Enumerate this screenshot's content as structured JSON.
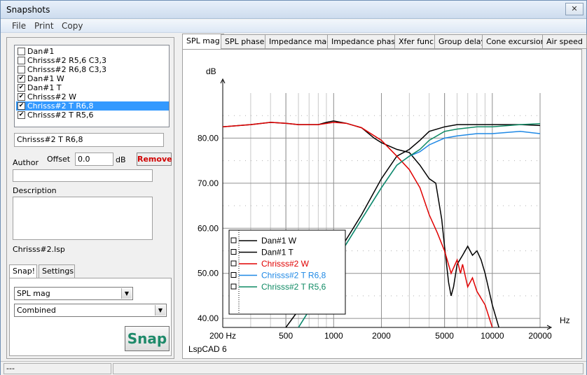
{
  "window": {
    "title": "Snapshots",
    "close": "✕"
  },
  "menu": [
    "File",
    "Print",
    "Copy"
  ],
  "snapshots": [
    {
      "label": "Dan#1",
      "checked": false,
      "selected": false
    },
    {
      "label": "Chrisss#2 R5,6 C3,3",
      "checked": false,
      "selected": false
    },
    {
      "label": "Chrisss#2 R6,8 C3,3",
      "checked": false,
      "selected": false
    },
    {
      "label": "Dan#1 W",
      "checked": true,
      "selected": false
    },
    {
      "label": "Dan#1 T",
      "checked": true,
      "selected": false
    },
    {
      "label": "Chrisss#2 W",
      "checked": true,
      "selected": false
    },
    {
      "label": "Chrisss#2 T R6,8",
      "checked": true,
      "selected": true
    },
    {
      "label": "Chrisss#2 T R5,6",
      "checked": true,
      "selected": false
    }
  ],
  "name_field": {
    "value": "Chrisss#2 T R6,8"
  },
  "author_label": "Author",
  "offset": {
    "label": "Offset",
    "value": "0.0",
    "unit": "dB"
  },
  "remove_label": "Remove",
  "author_value": "",
  "description_label": "Description",
  "description_value": "",
  "file_name": "Chrisss#2.lsp",
  "left_tabs": [
    "Snap!",
    "Settings"
  ],
  "measure_select": "SPL mag",
  "mode_select": "Combined",
  "snap_label": "Snap",
  "chart_tabs": [
    "SPL mag",
    "SPL phase",
    "Impedance mag",
    "Impedance phase",
    "Xfer func",
    "Group delay",
    "Cone excursion",
    "Air speed"
  ],
  "status": "---",
  "chart_data": {
    "type": "line",
    "ylabel": "dB",
    "xlabel": "Hz",
    "x_scale": "log",
    "xlim": [
      200,
      20000
    ],
    "ylim": [
      38,
      90
    ],
    "y_ticks": [
      "80.00",
      "70.00",
      "60.00",
      "50.00",
      "40.00"
    ],
    "y_tick_values": [
      80,
      70,
      60,
      50,
      40
    ],
    "x_ticks": [
      "200 Hz",
      "500",
      "1000",
      "2000",
      "5000",
      "10000",
      "20000"
    ],
    "x_tick_values": [
      200,
      500,
      1000,
      2000,
      5000,
      10000,
      20000
    ],
    "footer": "LspCAD 6",
    "grid": true,
    "legend_position": "bottom-left",
    "series": [
      {
        "name": "Dan#1 W",
        "color": "#000000",
        "points": [
          [
            200,
            82.5
          ],
          [
            300,
            83
          ],
          [
            400,
            83.5
          ],
          [
            500,
            83.3
          ],
          [
            600,
            83
          ],
          [
            800,
            83
          ],
          [
            900,
            83.5
          ],
          [
            1000,
            83.8
          ],
          [
            1200,
            83.3
          ],
          [
            1500,
            82.3
          ],
          [
            1800,
            80
          ],
          [
            2000,
            79
          ],
          [
            2500,
            77.5
          ],
          [
            3000,
            76.8
          ],
          [
            3500,
            74
          ],
          [
            4000,
            71
          ],
          [
            4400,
            70
          ],
          [
            4800,
            62
          ],
          [
            5000,
            56
          ],
          [
            5300,
            48
          ],
          [
            5500,
            45
          ],
          [
            5700,
            47
          ],
          [
            6000,
            52
          ],
          [
            6500,
            54
          ],
          [
            7000,
            56
          ],
          [
            7500,
            54
          ],
          [
            8000,
            55
          ],
          [
            8500,
            53
          ],
          [
            9000,
            50
          ],
          [
            10000,
            43
          ],
          [
            11000,
            38
          ]
        ]
      },
      {
        "name": "Dan#1 T",
        "color": "#000000",
        "points": [
          [
            500,
            38
          ],
          [
            700,
            45
          ],
          [
            1000,
            53
          ],
          [
            1500,
            63
          ],
          [
            2000,
            71
          ],
          [
            2500,
            76
          ],
          [
            3000,
            77.5
          ],
          [
            3500,
            79.5
          ],
          [
            4000,
            81.5
          ],
          [
            5000,
            82.5
          ],
          [
            6000,
            83
          ],
          [
            8000,
            83
          ],
          [
            10000,
            83
          ],
          [
            15000,
            83
          ],
          [
            20000,
            82.8
          ]
        ]
      },
      {
        "name": "Chrisss#2 W",
        "color": "#e00000",
        "points": [
          [
            200,
            82.5
          ],
          [
            300,
            83
          ],
          [
            400,
            83.5
          ],
          [
            500,
            83.3
          ],
          [
            600,
            83
          ],
          [
            800,
            83
          ],
          [
            1000,
            83.5
          ],
          [
            1200,
            83.3
          ],
          [
            1500,
            82.3
          ],
          [
            2000,
            79.5
          ],
          [
            2500,
            76
          ],
          [
            3000,
            73
          ],
          [
            3500,
            69
          ],
          [
            4000,
            63
          ],
          [
            4500,
            59
          ],
          [
            5000,
            55
          ],
          [
            5500,
            50
          ],
          [
            6000,
            53
          ],
          [
            6300,
            50
          ],
          [
            6500,
            52
          ],
          [
            7000,
            47
          ],
          [
            7500,
            49
          ],
          [
            8000,
            46
          ],
          [
            9000,
            43
          ],
          [
            10000,
            38
          ]
        ]
      },
      {
        "name": "Chrisss#2 T R6,8",
        "color": "#1e88e5",
        "points": [
          [
            600,
            38
          ],
          [
            800,
            45
          ],
          [
            1000,
            52
          ],
          [
            1500,
            62
          ],
          [
            2000,
            69
          ],
          [
            2500,
            74
          ],
          [
            3000,
            76
          ],
          [
            3500,
            77
          ],
          [
            4000,
            78.5
          ],
          [
            5000,
            80
          ],
          [
            6000,
            80.5
          ],
          [
            8000,
            81
          ],
          [
            10000,
            81
          ],
          [
            15000,
            81.5
          ],
          [
            20000,
            81
          ]
        ]
      },
      {
        "name": "Chrisss#2 T R5,6",
        "color": "#0f8a64",
        "points": [
          [
            600,
            38
          ],
          [
            800,
            45
          ],
          [
            1000,
            52
          ],
          [
            1500,
            62
          ],
          [
            2000,
            69
          ],
          [
            2500,
            74
          ],
          [
            3000,
            76
          ],
          [
            3500,
            77.5
          ],
          [
            4000,
            79.5
          ],
          [
            5000,
            81.5
          ],
          [
            6000,
            82
          ],
          [
            8000,
            82.5
          ],
          [
            10000,
            82.5
          ],
          [
            15000,
            83
          ],
          [
            20000,
            83.2
          ]
        ]
      }
    ]
  }
}
